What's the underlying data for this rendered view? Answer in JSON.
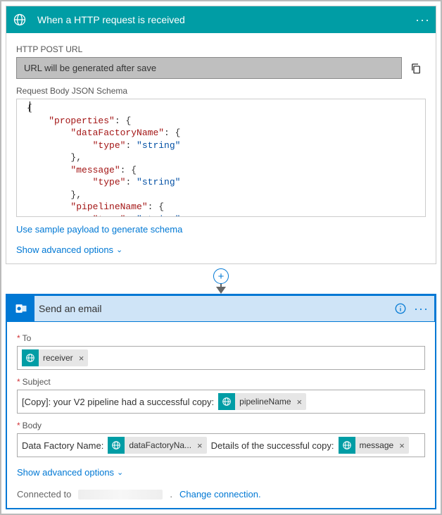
{
  "trigger": {
    "title": "When a HTTP request is received",
    "url_label": "HTTP POST URL",
    "url_value": "URL will be generated after save",
    "schema_label": "Request Body JSON Schema",
    "sample_link": "Use sample payload to generate schema",
    "advanced_link": "Show advanced options",
    "schema_tokens": [
      {
        "t": "plain",
        "v": "{"
      },
      {
        "t": "nl"
      },
      {
        "t": "indent",
        "n": 1
      },
      {
        "t": "key",
        "v": "\"properties\""
      },
      {
        "t": "plain",
        "v": ": {"
      },
      {
        "t": "nl"
      },
      {
        "t": "indent",
        "n": 2
      },
      {
        "t": "key",
        "v": "\"dataFactoryName\""
      },
      {
        "t": "plain",
        "v": ": {"
      },
      {
        "t": "nl"
      },
      {
        "t": "indent",
        "n": 3
      },
      {
        "t": "key",
        "v": "\"type\""
      },
      {
        "t": "plain",
        "v": ": "
      },
      {
        "t": "str",
        "v": "\"string\""
      },
      {
        "t": "nl"
      },
      {
        "t": "indent",
        "n": 2
      },
      {
        "t": "plain",
        "v": "},"
      },
      {
        "t": "nl"
      },
      {
        "t": "indent",
        "n": 2
      },
      {
        "t": "key",
        "v": "\"message\""
      },
      {
        "t": "plain",
        "v": ": {"
      },
      {
        "t": "nl"
      },
      {
        "t": "indent",
        "n": 3
      },
      {
        "t": "key",
        "v": "\"type\""
      },
      {
        "t": "plain",
        "v": ": "
      },
      {
        "t": "str",
        "v": "\"string\""
      },
      {
        "t": "nl"
      },
      {
        "t": "indent",
        "n": 2
      },
      {
        "t": "plain",
        "v": "},"
      },
      {
        "t": "nl"
      },
      {
        "t": "indent",
        "n": 2
      },
      {
        "t": "key",
        "v": "\"pipelineName\""
      },
      {
        "t": "plain",
        "v": ": {"
      },
      {
        "t": "nl"
      },
      {
        "t": "indent",
        "n": 3
      },
      {
        "t": "key",
        "v": "\"type\""
      },
      {
        "t": "plain",
        "v": ": "
      },
      {
        "t": "str",
        "v": "\"string\""
      }
    ]
  },
  "action": {
    "title": "Send an email",
    "to_label": "To",
    "subject_label": "Subject",
    "body_label": "Body",
    "advanced_link": "Show advanced options",
    "connected_prefix": "Connected to",
    "change_conn": "Change connection.",
    "to_tokens": [
      {
        "type": "token",
        "label": "receiver"
      }
    ],
    "subject_parts": [
      {
        "type": "text",
        "value": "[Copy]: your V2 pipeline had a successful copy:"
      },
      {
        "type": "token",
        "label": "pipelineName"
      }
    ],
    "body_parts": [
      {
        "type": "text",
        "value": "Data Factory Name:"
      },
      {
        "type": "token",
        "label": "dataFactoryNa..."
      },
      {
        "type": "text",
        "value": "Details of the successful copy:"
      },
      {
        "type": "token",
        "label": "message"
      }
    ]
  }
}
